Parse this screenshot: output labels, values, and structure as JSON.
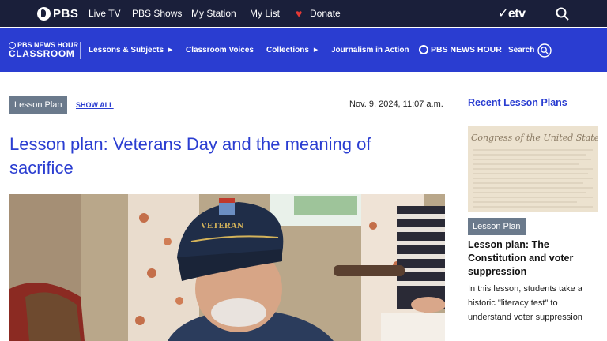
{
  "topbar": {
    "logo": "PBS",
    "links": [
      "Live TV",
      "PBS Shows",
      "My Station",
      "My List"
    ],
    "donate": "Donate",
    "etv": "etv",
    "heart_color": "#e53935"
  },
  "navbar": {
    "logo_small": "PBS NEWS HOUR",
    "logo_big": "CLASSROOM",
    "items": [
      {
        "label": "Lessons & Subjects",
        "has_dropdown": true
      },
      {
        "label": "Classroom Voices",
        "has_dropdown": false
      },
      {
        "label": "Collections",
        "has_dropdown": true
      },
      {
        "label": "Journalism in Action",
        "has_dropdown": false
      }
    ],
    "newshour_logo": "PBS NEWS HOUR",
    "search_label": "Search",
    "accent": "#2a3dd1"
  },
  "article": {
    "tag": "Lesson Plan",
    "show_all": "SHOW ALL",
    "dateline": "Nov. 9, 2024, 11:07 a.m.",
    "title": "Lesson plan: Veterans Day and the meaning of sacrifice",
    "hero_cap_text": "VETERAN"
  },
  "sidebar": {
    "heading": "Recent Lesson Plans",
    "thumb_caption": "Congress of the United States,",
    "tag": "Lesson Plan",
    "item_title": "Lesson plan: The Constitution and voter suppression",
    "item_desc": "In this lesson, students take a historic \"literacy test\" to understand voter suppression"
  }
}
